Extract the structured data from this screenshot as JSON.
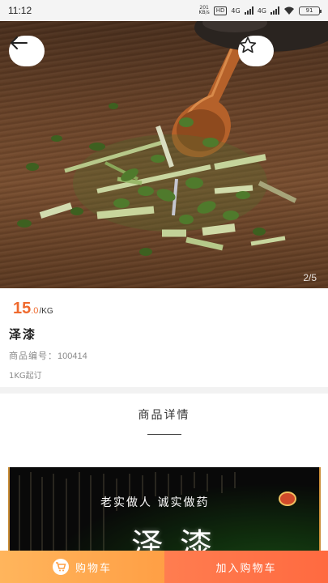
{
  "status_bar": {
    "time": "11:12",
    "speed": "201\nKB/s",
    "network_badge": "HD",
    "net_1": "4G",
    "net_2": "4G",
    "battery": "91"
  },
  "hero": {
    "image_counter": "2/5",
    "icons": {
      "back": "arrow-left-icon",
      "favorite": "star-outline-icon"
    }
  },
  "product": {
    "price_integer": "15",
    "price_decimal": ".0",
    "price_unit": "/KG",
    "name": "泽漆",
    "code_label": "商品编号：",
    "code_value": "100414",
    "min_order": "1KG起订"
  },
  "details": {
    "section_title": "商品详情",
    "banner_slogan": "老实做人 诚实做药",
    "banner_title": "泽漆"
  },
  "bottom_bar": {
    "cart_label": "购物车",
    "add_to_cart_label": "加入购物车"
  },
  "colors": {
    "price": "#ef6a2e",
    "cart_button": "#ffa850",
    "add_to_cart_button": "#ff6f45",
    "divider": "#f2f2f2"
  }
}
